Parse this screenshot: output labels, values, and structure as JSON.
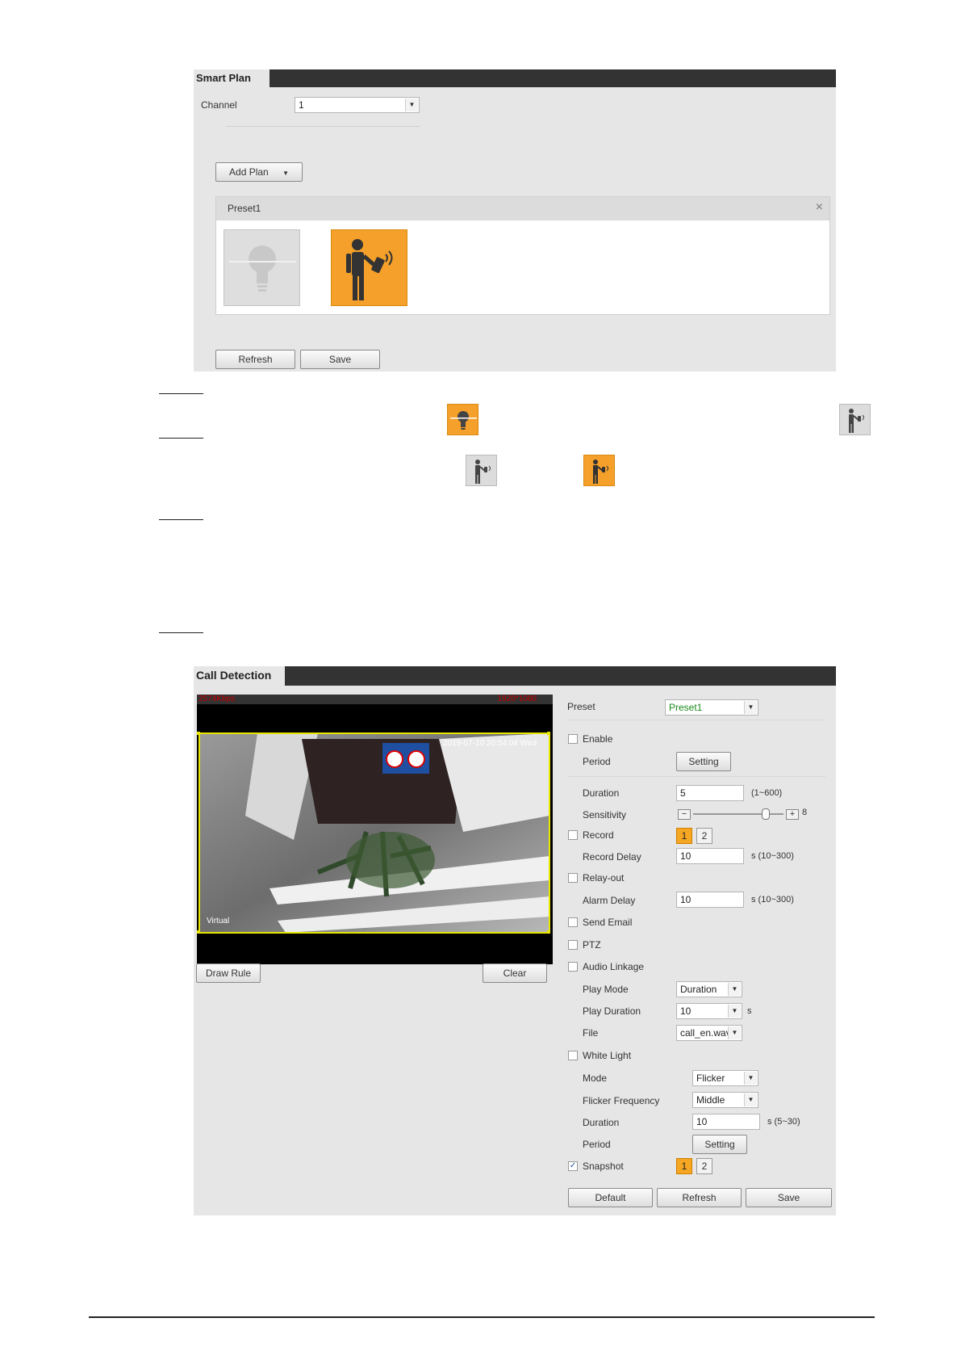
{
  "smart_plan": {
    "title": "Smart Plan",
    "channel_label": "Channel",
    "channel_value": "1",
    "add_plan_label": "Add Plan",
    "preset_name": "Preset1",
    "close_glyph": "×",
    "refresh_label": "Refresh",
    "save_label": "Save",
    "plans": [
      {
        "icon": "bulb-icon",
        "state": "inactive"
      },
      {
        "icon": "person-phone-icon",
        "state": "active"
      }
    ]
  },
  "inline_icons": [
    {
      "icon": "bulb-icon",
      "state": "active"
    },
    {
      "icon": "person-phone-icon",
      "state": "inactive"
    },
    {
      "icon": "person-phone-icon",
      "state": "inactive"
    },
    {
      "icon": "person-phone-icon",
      "state": "active"
    }
  ],
  "call_detection": {
    "title": "Call Detection",
    "video": {
      "bitrate": "2574Kbps",
      "resolution": "1920*1080",
      "timestamp": "2019-07-10 20:54:04 Wed",
      "overlay_label": "Virtual"
    },
    "draw_rule_label": "Draw Rule",
    "clear_label": "Clear",
    "preset_label": "Preset",
    "preset_value": "Preset1",
    "enable_label": "Enable",
    "period_label": "Period",
    "setting_label": "Setting",
    "duration_label": "Duration",
    "duration_value": "5",
    "duration_hint": "(1~600)",
    "sensitivity_label": "Sensitivity",
    "sensitivity_value": "8",
    "sensitivity_level": 0.8,
    "record_label": "Record",
    "record_delay_label": "Record Delay",
    "record_delay_value": "10",
    "record_delay_hint": "s (10~300)",
    "relay_out_label": "Relay-out",
    "alarm_delay_label": "Alarm Delay",
    "alarm_delay_value": "10",
    "alarm_delay_hint": "s (10~300)",
    "send_email_label": "Send Email",
    "ptz_label": "PTZ",
    "audio_linkage_label": "Audio Linkage",
    "play_mode_label": "Play Mode",
    "play_mode_value": "Duration",
    "play_duration_label": "Play Duration",
    "play_duration_value": "10",
    "play_duration_unit": "s",
    "file_label": "File",
    "file_value": "call_en.wav",
    "white_light_label": "White Light",
    "mode_label": "Mode",
    "mode_value": "Flicker",
    "flicker_freq_label": "Flicker Frequency",
    "flicker_freq_value": "Middle",
    "wl_duration_label": "Duration",
    "wl_duration_value": "10",
    "wl_duration_hint": "s (5~30)",
    "wl_period_label": "Period",
    "wl_setting_label": "Setting",
    "snapshot_label": "Snapshot",
    "snapshot_checked": true,
    "channel_one": "1",
    "channel_two": "2",
    "default_label": "Default",
    "refresh_label": "Refresh",
    "save_label": "Save",
    "check_glyph": "✓",
    "arrow_glyph": "▼",
    "minus_glyph": "−",
    "plus_glyph": "+"
  }
}
